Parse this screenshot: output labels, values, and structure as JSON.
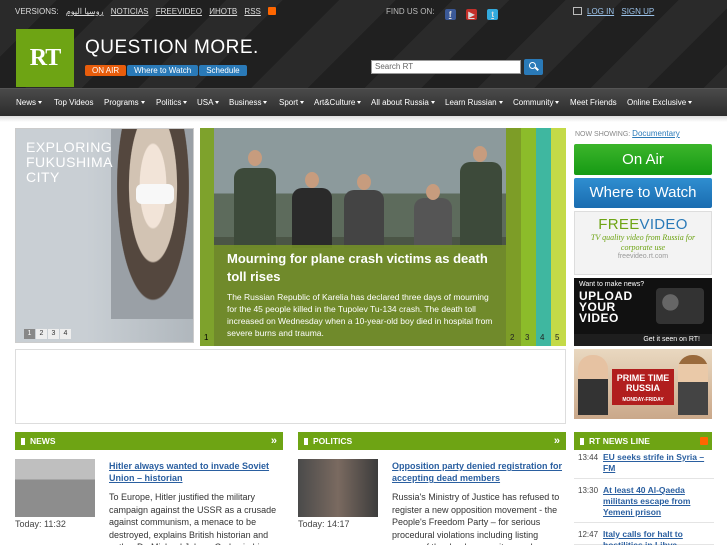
{
  "topbar": {
    "versions_label": "VERSIONS:",
    "versions": [
      "روسيا اليوم",
      "NOTICIAS",
      "FREEVIDEO",
      "ИНОТВ",
      "RSS"
    ],
    "find_us": "FIND US ON:",
    "login": "LOG IN",
    "signup": "SIGN UP"
  },
  "brand": {
    "logo_text": "RT",
    "tagline": "QUESTION MORE.",
    "buttons": [
      "ON AIR",
      "Where to Watch",
      "Schedule"
    ]
  },
  "search": {
    "placeholder": "Search RT"
  },
  "nav": {
    "items": [
      "News",
      "Top Videos",
      "Programs",
      "Politics",
      "USA",
      "Business",
      "Sport",
      "Art&Culture",
      "All about Russia",
      "Learn Russian",
      "Community",
      "Meet Friends",
      "Online Exclusive"
    ]
  },
  "feature_left": {
    "title": "EXPLORING FUKUSHIMA CITY",
    "pages": [
      "1",
      "2",
      "3",
      "4"
    ]
  },
  "feature_main": {
    "headline": "Mourning for plane crash victims as death toll rises",
    "summary": "The Russian Republic of Karelia has declared three days of mourning for the 45 people killed in the Tupolev Tu-134 crash. The death toll increased on Wednesday when a 10-year-old boy died in hospital from severe burns and trauma.",
    "tabs": [
      "1",
      "2",
      "3",
      "4",
      "5"
    ]
  },
  "sidebar": {
    "now_showing_label": "NOW SHOWING:",
    "now_showing_value": "Documentary",
    "on_air": "On Air",
    "where_to_watch": "Where to Watch",
    "freevideo_title_a": "FREE",
    "freevideo_title_b": "VIDEO",
    "freevideo_sub": "TV quality video from Russia for corporate use",
    "freevideo_url": "freevideo.rt.com",
    "upload_small": "Want to make news?",
    "upload_big": "UPLOAD YOUR VIDEO",
    "upload_cta": "Get it seen on RT!",
    "primetime_title": "PRIME TIME RUSSIA",
    "primetime_sub": "MONDAY-FRIDAY"
  },
  "news": {
    "header": "NEWS",
    "more": "»",
    "time": "Today: 11:32",
    "headline": "Hitler always wanted to invade Soviet Union – historian",
    "lead": "To Europe, Hitler justified the military campaign against the USSR as a crusade against communism, a menace to be destroyed, explains British historian and author Dr. Michael Jabara Carley in his"
  },
  "politics": {
    "header": "POLITICS",
    "more": "»",
    "time": "Today: 14:17",
    "headline": "Opposition party denied registration for accepting dead members",
    "lead": "Russia's Ministry of Justice has refused to register a new opposition movement - the People's Freedom Party – for serious procedural violations including listing names of the dead among its members"
  },
  "rt_news_line": {
    "header": "RT NEWS LINE",
    "items": [
      {
        "time": "13:44",
        "headline": "EU seeks strife in Syria – FM"
      },
      {
        "time": "13:30",
        "headline": "At least 40 Al-Qaeda militants escape from Yemeni prison"
      },
      {
        "time": "12:47",
        "headline": "Italy calls for halt to hostilities in Libya"
      }
    ]
  },
  "colors": {
    "brand_green": "#6ea414",
    "link_blue": "#2a5fa0",
    "on_air_orange": "#e85d0c",
    "header_dark": "#222222"
  }
}
